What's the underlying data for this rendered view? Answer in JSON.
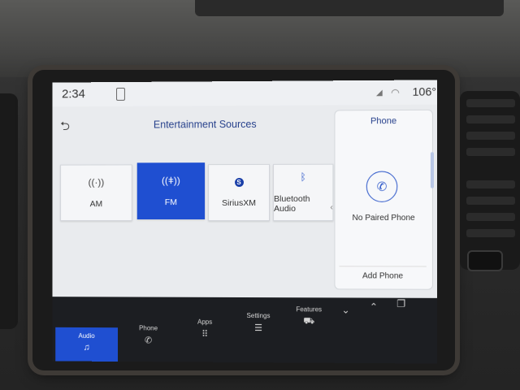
{
  "status_bar": {
    "time": "2:34",
    "temperature": "106°",
    "icons": [
      "phone-icon",
      "signal-icon",
      "wifi-icon"
    ]
  },
  "header": {
    "back_icon": "back-arrow-icon",
    "title": "Entertainment Sources"
  },
  "sources": [
    {
      "label": "AM",
      "icon": "antenna-icon",
      "selected": false
    },
    {
      "label": "FM",
      "icon": "radio-wave-icon",
      "selected": true
    },
    {
      "label": "SiriusXM",
      "icon": "siriusxm-icon",
      "badge": "S",
      "selected": false
    },
    {
      "label": "Bluetooth Audio",
      "icon": "bluetooth-icon",
      "selected": false
    }
  ],
  "phone_panel": {
    "title": "Phone",
    "status": "No Paired Phone",
    "action": "Add Phone",
    "icon": "phone-handset-icon"
  },
  "nav": {
    "items": [
      {
        "label": "Audio",
        "icon": "music-note-icon",
        "active": true
      },
      {
        "label": "Phone",
        "icon": "phone-icon",
        "active": false
      },
      {
        "label": "Apps",
        "icon": "apps-grid-icon",
        "active": false
      },
      {
        "label": "Settings",
        "icon": "sliders-icon",
        "active": false
      },
      {
        "label": "Features",
        "icon": "car-icon",
        "active": false
      }
    ],
    "controls": [
      "chevron-down-icon",
      "chevron-up-icon",
      "copy-icon"
    ]
  },
  "colors": {
    "accent": "#1f4fd1",
    "title_blue": "#27418c",
    "nav_bg": "#1c1e22",
    "screen_bg": "#e9ebee"
  }
}
